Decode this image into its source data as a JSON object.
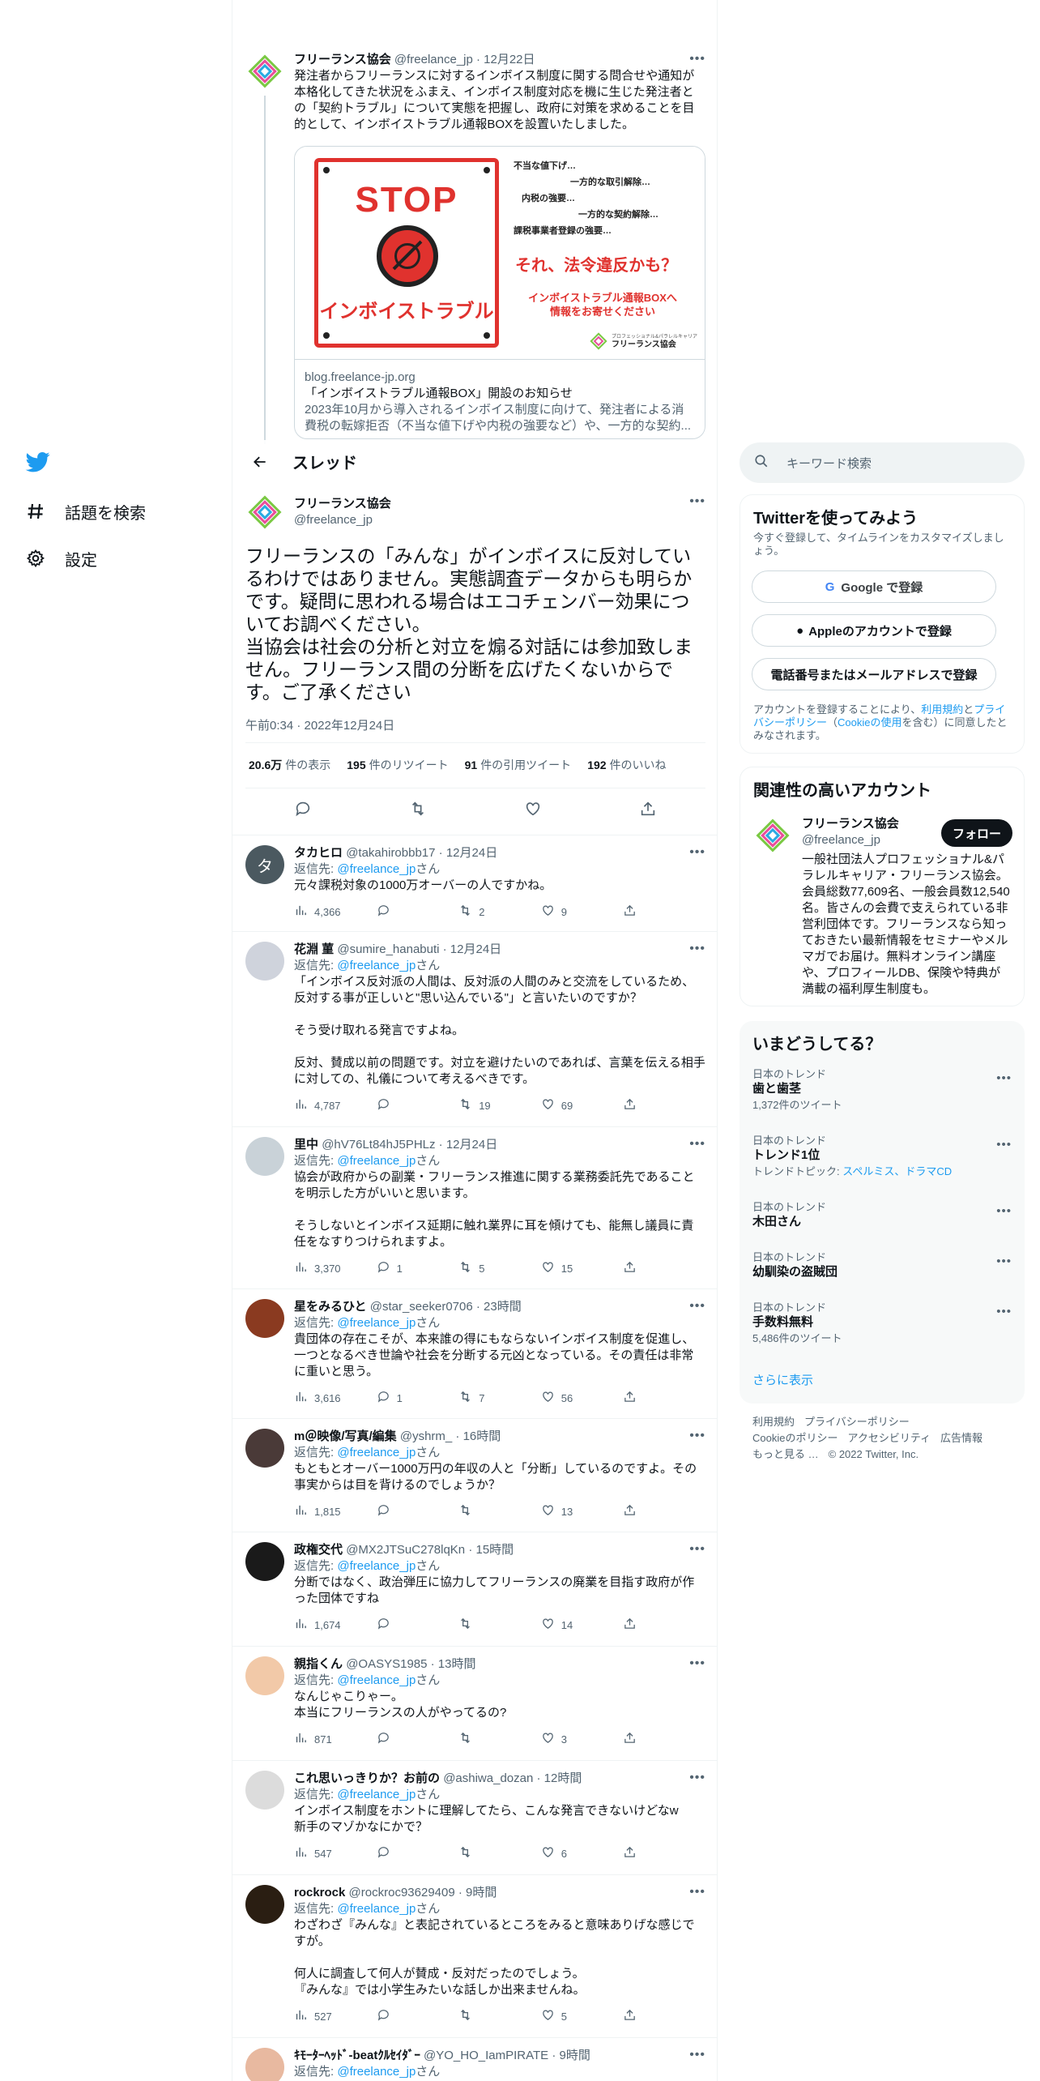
{
  "nav": {
    "items": [
      {
        "label": "話題を検索",
        "icon": "hashtag-icon"
      },
      {
        "label": "設定",
        "icon": "gear-icon"
      }
    ]
  },
  "top_tweet": {
    "name": "フリーランス協会",
    "meta": "@freelance_jp · 12月22日",
    "text": "発注者からフリーランスに対するインボイス制度に関する問合せや通知が本格化してきた状況をふまえ、インボイス制度対応を機に生じた発注者との「契約トラブル」について実態を把握し、政府に対策を求めることを目的として、インボイストラブル通報BOXを設置いたしました。",
    "card": {
      "stop": "STOP",
      "sign_caption": "インボイストラブル",
      "lines": [
        "不当な値下げ…",
        "一方的な取引解除…",
        "内税の強要…",
        "一方的な契約解除…",
        "課税事業者登録の強要…"
      ],
      "headline": "それ、法令違反かも？",
      "cta": "インボイストラブル通報BOXへ\n情報をお寄せください",
      "org_small": "プロフェッショナル&パラレルキャリア",
      "org": "フリーランス協会",
      "domain": "blog.freelance-jp.org",
      "title": "「インボイストラブル通報BOX」開設のお知らせ",
      "desc": "2023年10月から導入されるインボイス制度に向けて、発注者による消費税の転嫁拒否（不当な値下げや内税の強要など）や、一方的な契約..."
    }
  },
  "header": {
    "title": "スレッド"
  },
  "main_tweet": {
    "name": "フリーランス協会",
    "handle": "@freelance_jp",
    "text": "フリーランスの「みんな」がインボイスに反対しているわけではありません。実態調査データからも明らかです。疑問に思われる場合はエコチェンバー効果についてお調べください。\n当協会は社会の分析と対立を煽る対話には参加致しません。フリーランス間の分断を広げたくないからです。ご了承ください",
    "time": "午前0:34 · 2022年12月24日",
    "stats": [
      {
        "num": "20.6万",
        "label": "件の表示"
      },
      {
        "num": "195",
        "label": "件のリツイート"
      },
      {
        "num": "91",
        "label": "件の引用ツイート"
      },
      {
        "num": "192",
        "label": "件のいいね"
      }
    ]
  },
  "replies": [
    {
      "name": "タカヒロ",
      "meta": "@takahirobbb17 · 12月24日",
      "reply_prefix": "返信先: ",
      "reply_handle": "@freelance_jp",
      "reply_suffix": "さん",
      "text": "元々課税対象の1000万オーバーの人ですかね。",
      "views": "4,366",
      "replies": "",
      "rts": "2",
      "likes": "9"
    },
    {
      "name": "花淵 菫",
      "meta": "@sumire_hanabuti · 12月24日",
      "reply_prefix": "返信先: ",
      "reply_handle": "@freelance_jp",
      "reply_suffix": "さん",
      "text": "「インボイス反対派の人間は、反対派の人間のみと交流をしているため、反対する事が正しいと\"思い込んでいる\"」と言いたいのですか？\n\nそう受け取れる発言ですよね。\n\n反対、賛成以前の問題です。対立を避けたいのであれば、言葉を伝える相手に対しての、礼儀について考えるべきです。",
      "views": "4,787",
      "replies": "",
      "rts": "19",
      "likes": "69"
    },
    {
      "name": "里中",
      "meta": "@hV76Lt84hJ5PHLz · 12月24日",
      "reply_prefix": "返信先: ",
      "reply_handle": "@freelance_jp",
      "reply_suffix": "さん",
      "text": "協会が政府からの副業・フリーランス推進に関する業務委託先であることを明示した方がいいと思います。\n\nそうしないとインボイス延期に触れ業界に耳を傾けても、能無し議員に責任をなすりつけられますよ。",
      "views": "3,370",
      "replies": "1",
      "rts": "5",
      "likes": "15"
    },
    {
      "name": "星をみるひと",
      "meta": "@star_seeker0706 · 23時間",
      "reply_prefix": "返信先: ",
      "reply_handle": "@freelance_jp",
      "reply_suffix": "さん",
      "text": "貴団体の存在こそが、本来誰の得にもならないインボイス制度を促進し、一つとなるべき世論や社会を分断する元凶となっている。その責任は非常に重いと思う。",
      "views": "3,616",
      "replies": "1",
      "rts": "7",
      "likes": "56"
    },
    {
      "name": "m＠映像/写真/編集",
      "meta": "@yshrm_ · 16時間",
      "reply_prefix": "返信先: ",
      "reply_handle": "@freelance_jp",
      "reply_suffix": "さん",
      "text": "もともとオーバー1000万円の年収の人と「分断」しているのですよ。その事実からは目を背けるのでしょうか？",
      "views": "1,815",
      "replies": "",
      "rts": "",
      "likes": "13"
    },
    {
      "name": "政権交代",
      "meta": "@MX2JTSuC278lqKn · 15時間",
      "reply_prefix": "返信先: ",
      "reply_handle": "@freelance_jp",
      "reply_suffix": "さん",
      "text": "分断ではなく、政治弾圧に協力してフリーランスの廃業を目指す政府が作った団体ですね",
      "views": "1,674",
      "replies": "",
      "rts": "",
      "likes": "14"
    },
    {
      "name": "親指くん",
      "meta": "@OASYS1985 · 13時間",
      "reply_prefix": "返信先: ",
      "reply_handle": "@freelance_jp",
      "reply_suffix": "さん",
      "text": "なんじゃこりゃー。\n本当にフリーランスの人がやってるの?",
      "views": "871",
      "replies": "",
      "rts": "",
      "likes": "3"
    },
    {
      "name": "これ思いっきりか？お前の",
      "meta": "@ashiwa_dozan · 12時間",
      "reply_prefix": "返信先: ",
      "reply_handle": "@freelance_jp",
      "reply_suffix": "さん",
      "text": "インボイス制度をホントに理解してたら、こんな発言できないけどなw\n新手のマゾかなにかで？",
      "views": "547",
      "replies": "",
      "rts": "",
      "likes": "6"
    },
    {
      "name": "rockrock",
      "meta": "@rockroc93629409 · 9時間",
      "reply_prefix": "返信先: ",
      "reply_handle": "@freelance_jp",
      "reply_suffix": "さん",
      "text": "わざわざ『みんな』と表記されているところをみると意味ありげな感じですが。\n\n何人に調査して何人が賛成・反対だったのでしょう。\n『みんな』では小学生みたいな話しか出来ませんね。",
      "views": "527",
      "replies": "",
      "rts": "",
      "likes": "5"
    },
    {
      "name": "ｷﾓｰﾀｰﾍｯﾄﾞ-beatｸﾙｾｲﾀﾞｰ",
      "meta": "@YO_HO_IamPIRATE · 9時間",
      "reply_prefix": "返信先: ",
      "reply_handle": "@freelance_jp",
      "reply_suffix": "さん",
      "text": "",
      "views": "",
      "replies": "",
      "rts": "",
      "likes": ""
    }
  ],
  "search": {
    "placeholder": "キーワード検索"
  },
  "signup": {
    "title": "Twitterを使ってみよう",
    "subtitle": "今すぐ登録して、タイムラインをカスタマイズしましょう。",
    "google": "Google で登録",
    "apple": "Appleのアカウントで登録",
    "phone": "電話番号またはメールアドレスで登録",
    "legal_1": "アカウントを登録することにより、",
    "legal_terms": "利用規約",
    "legal_2": "と",
    "legal_privacy": "プライバシーポリシー",
    "legal_3": "（",
    "legal_cookie": "Cookieの使用",
    "legal_4": "を含む）に同意したとみなされます。"
  },
  "related": {
    "title": "関連性の高いアカウント",
    "name": "フリーランス協会",
    "handle": "@freelance_jp",
    "follow": "フォロー",
    "bio": "一般社団法人プロフェッショナル&パラレルキャリア・フリーランス協会。会員総数77,609名、一般会員数12,540名。皆さんの会費で支えられている非営利団体です。フリーランスなら知っておきたい最新情報をセミナーやメルマガでお届け。無料オンライン講座や、プロフィールDB、保険や特典が満載の福利厚生制度も。"
  },
  "trends": {
    "title": "いまどうしてる？",
    "items": [
      {
        "context": "日本のトレンド",
        "name": "歯と歯茎",
        "count": "1,372件のツイート"
      },
      {
        "context": "日本のトレンド",
        "name": "トレンド1位",
        "topic_label": "トレンドトピック: ",
        "topic": "スペルミス、ドラマCD"
      },
      {
        "context": "日本のトレンド",
        "name": "木田さん"
      },
      {
        "context": "日本のトレンド",
        "name": "幼馴染の盗賊団"
      },
      {
        "context": "日本のトレンド",
        "name": "手数料無料",
        "count": "5,486件のツイート"
      }
    ],
    "more": "さらに表示"
  },
  "footer": {
    "links": [
      "利用規約",
      "プライバシーポリシー",
      "Cookieのポリシー",
      "アクセシビリティ",
      "広告情報",
      "もっと見る …"
    ],
    "copyright": "© 2022 Twitter, Inc."
  },
  "colors": {
    "accent": "#1d9bf0",
    "text": "#0f1419",
    "muted": "#536471",
    "stop_red": "#e0322e"
  }
}
